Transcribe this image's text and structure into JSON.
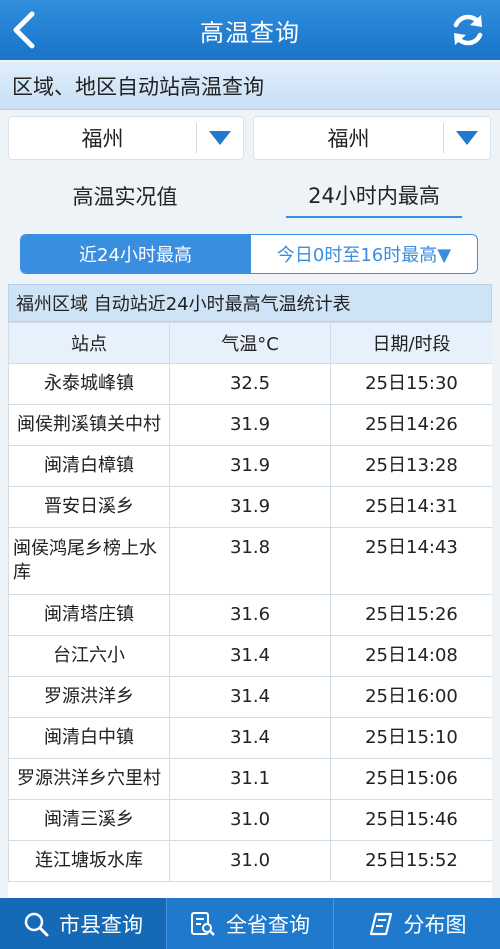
{
  "header": {
    "title": "高温查询"
  },
  "subheader": {
    "title": "区域、地区自动站高温查询"
  },
  "selectors": {
    "left": "福州",
    "right": "福州"
  },
  "mode_tabs": [
    "高温实况值",
    "24小时内最高"
  ],
  "segments": {
    "active": "近24小时最高",
    "inactive": "今日0时至16时最高▼"
  },
  "table": {
    "title": "福州区域 自动站近24小时最高气温统计表",
    "headers": [
      "站点",
      "气温°C",
      "日期/时段"
    ],
    "rows": [
      [
        "永泰城峰镇",
        "32.5",
        "25日15:30"
      ],
      [
        "闽侯荆溪镇关中村",
        "31.9",
        "25日14:26"
      ],
      [
        "闽清白樟镇",
        "31.9",
        "25日13:28"
      ],
      [
        "晋安日溪乡",
        "31.9",
        "25日14:31"
      ],
      [
        "闽侯鸿尾乡榜上水库",
        "31.8",
        "25日14:43"
      ],
      [
        "闽清塔庄镇",
        "31.6",
        "25日15:26"
      ],
      [
        "台江六小",
        "31.4",
        "25日14:08"
      ],
      [
        "罗源洪洋乡",
        "31.4",
        "25日16:00"
      ],
      [
        "闽清白中镇",
        "31.4",
        "25日15:10"
      ],
      [
        "罗源洪洋乡穴里村",
        "31.1",
        "25日15:06"
      ],
      [
        "闽清三溪乡",
        "31.0",
        "25日15:46"
      ],
      [
        "连江塘坂水库",
        "31.0",
        "25日15:52"
      ]
    ]
  },
  "bottom_nav": [
    {
      "label": "市县查询",
      "icon": "search-icon"
    },
    {
      "label": "全省查询",
      "icon": "list-search-icon"
    },
    {
      "label": "分布图",
      "icon": "map-icon"
    }
  ],
  "colors": {
    "header": "#1a74c9",
    "accent": "#3a8ee0",
    "nav": "#1f79cc"
  }
}
